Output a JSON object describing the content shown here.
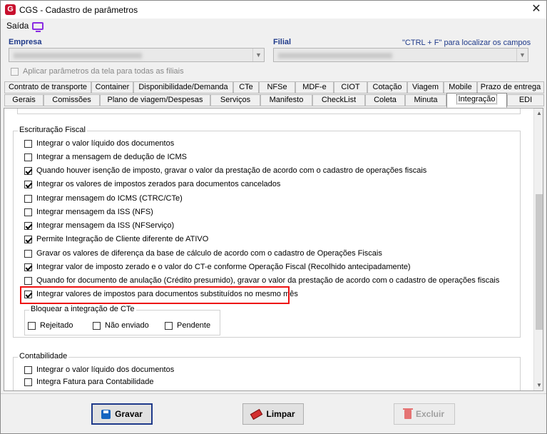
{
  "window": {
    "title": "CGS - Cadastro de parâmetros",
    "close_symbol": "✕",
    "app_icon": "G"
  },
  "menu": {
    "saida_label": "Saída"
  },
  "header": {
    "empresa_label": "Empresa",
    "filial_label": "Filial",
    "search_hint": "\"CTRL + F\" para localizar os campos",
    "apply_all_label": "Aplicar parâmetros da tela para todas as filiais",
    "apply_all_checked": false
  },
  "tabs_row1": [
    {
      "label": "Contrato de transporte"
    },
    {
      "label": "Container"
    },
    {
      "label": "Disponibilidade/Demanda"
    },
    {
      "label": "CTe"
    },
    {
      "label": "NFSe"
    },
    {
      "label": "MDF-e"
    },
    {
      "label": "CIOT"
    },
    {
      "label": "Cotação"
    },
    {
      "label": "Viagem"
    },
    {
      "label": "Mobile"
    },
    {
      "label": "Prazo de entrega"
    }
  ],
  "tabs_row2": [
    {
      "label": "Gerais"
    },
    {
      "label": "Comissões"
    },
    {
      "label": "Plano de viagem/Despesas"
    },
    {
      "label": "Serviços"
    },
    {
      "label": "Manifesto"
    },
    {
      "label": "CheckList"
    },
    {
      "label": "Coleta"
    },
    {
      "label": "Minuta"
    },
    {
      "label": "Integração",
      "active": true
    },
    {
      "label": "EDI"
    }
  ],
  "escrituracao": {
    "title": "Escrituração Fiscal",
    "items": [
      {
        "label": "Integrar o valor líquido dos documentos",
        "checked": false
      },
      {
        "label": "Integrar a mensagem de dedução de ICMS",
        "checked": false
      },
      {
        "label": "Quando houver isenção de imposto, gravar o valor da prestação de acordo com o cadastro de operações fiscais",
        "checked": true
      },
      {
        "label": "Integrar os valores de impostos zerados para documentos cancelados",
        "checked": true
      },
      {
        "label": "Integrar mensagem do ICMS (CTRC/CTe)",
        "checked": false
      },
      {
        "label": "Integrar mensagem da ISS (NFS)",
        "checked": false
      },
      {
        "label": "Integrar mensagem da ISS (NFServiço)",
        "checked": true
      },
      {
        "label": "Permite Integração de Cliente diferente de ATIVO",
        "checked": true
      },
      {
        "label": "Gravar os valores de diferença da base de cálculo de acordo com o cadastro de Operações Fiscais",
        "checked": false
      },
      {
        "label": "Integrar valor de imposto zerado e o valor do CT-e conforme Operação Fiscal (Recolhido antecipadamente)",
        "checked": true
      },
      {
        "label": "Quando for documento de anulação (Crédito presumido), gravar o valor da prestação de acordo com o cadastro de operações fiscais",
        "checked": false
      },
      {
        "label": "Integrar valores de impostos para documentos substituídos no mesmo mês",
        "checked": true
      }
    ]
  },
  "bloquear": {
    "title": "Bloquear a integração de CTe",
    "options": [
      {
        "label": "Rejeitado",
        "checked": false
      },
      {
        "label": "Não enviado",
        "checked": false
      },
      {
        "label": "Pendente",
        "checked": false
      }
    ]
  },
  "contabilidade": {
    "title": "Contabilidade",
    "items": [
      {
        "label": "Integrar o valor líquido dos documentos",
        "checked": false
      },
      {
        "label": "Integra Fatura para Contabilidade",
        "checked": false
      }
    ]
  },
  "footer": {
    "gravar_label": "Gravar",
    "limpar_label": "Limpar",
    "excluir_label": "Excluir"
  },
  "colors": {
    "accent": "#1f3a8a",
    "highlight": "#ee1111",
    "brand": "#c8102e"
  }
}
